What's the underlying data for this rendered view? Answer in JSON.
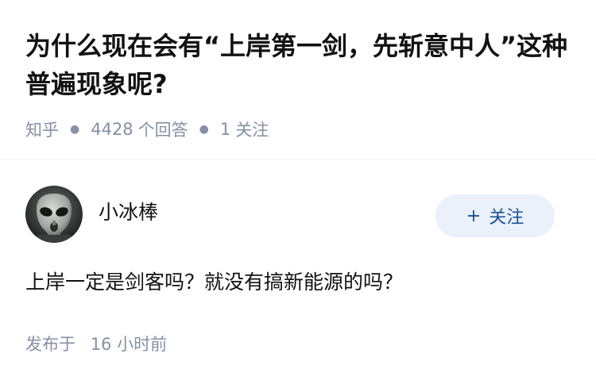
{
  "question": {
    "title": "为什么现在会有“上岸第一剑，先斩意中人”这种普遍现象呢?",
    "source": "知乎",
    "answer_count": "4428",
    "answer_label": "个回答",
    "follow_count": "1",
    "follow_label": "关注"
  },
  "answer": {
    "author_name": "小冰棒",
    "follow_button_label": "关注",
    "follow_button_icon": "plus-icon",
    "content": "上岸一定是剑客吗？就没有搞新能源的吗？",
    "time_prefix": "发布于",
    "time_value": "16 小时前"
  },
  "colors": {
    "title": "#121212",
    "meta": "#8590a6",
    "follow_bg": "#ebf1fa",
    "follow_text": "#175199"
  }
}
